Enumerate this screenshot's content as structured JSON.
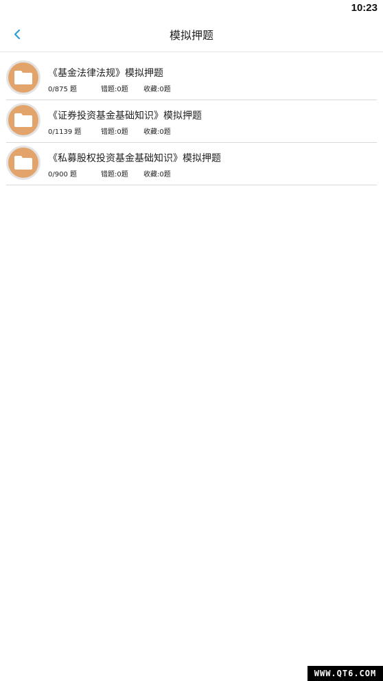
{
  "status_bar": {
    "time": "10:23"
  },
  "header": {
    "title": "模拟押题",
    "back_icon": "chevron-left-icon",
    "accent_color": "#2a9fd6"
  },
  "items": [
    {
      "title": "《基金法律法规》模拟押题",
      "progress": "0/875 题",
      "wrong": "错题:0题",
      "favorites": "收藏:0题",
      "icon": "folder-icon",
      "icon_color": "#e2a46b"
    },
    {
      "title": "《证券投资基金基础知识》模拟押题",
      "progress": "0/1139 题",
      "wrong": "错题:0题",
      "favorites": "收藏:0题",
      "icon": "folder-icon",
      "icon_color": "#e2a46b"
    },
    {
      "title": "《私募股权投资基金基础知识》模拟押题",
      "progress": "0/900 题",
      "wrong": "错题:0题",
      "favorites": "收藏:0题",
      "icon": "folder-icon",
      "icon_color": "#e2a46b"
    }
  ],
  "watermark": {
    "text": "WWW.QT6.COM"
  }
}
